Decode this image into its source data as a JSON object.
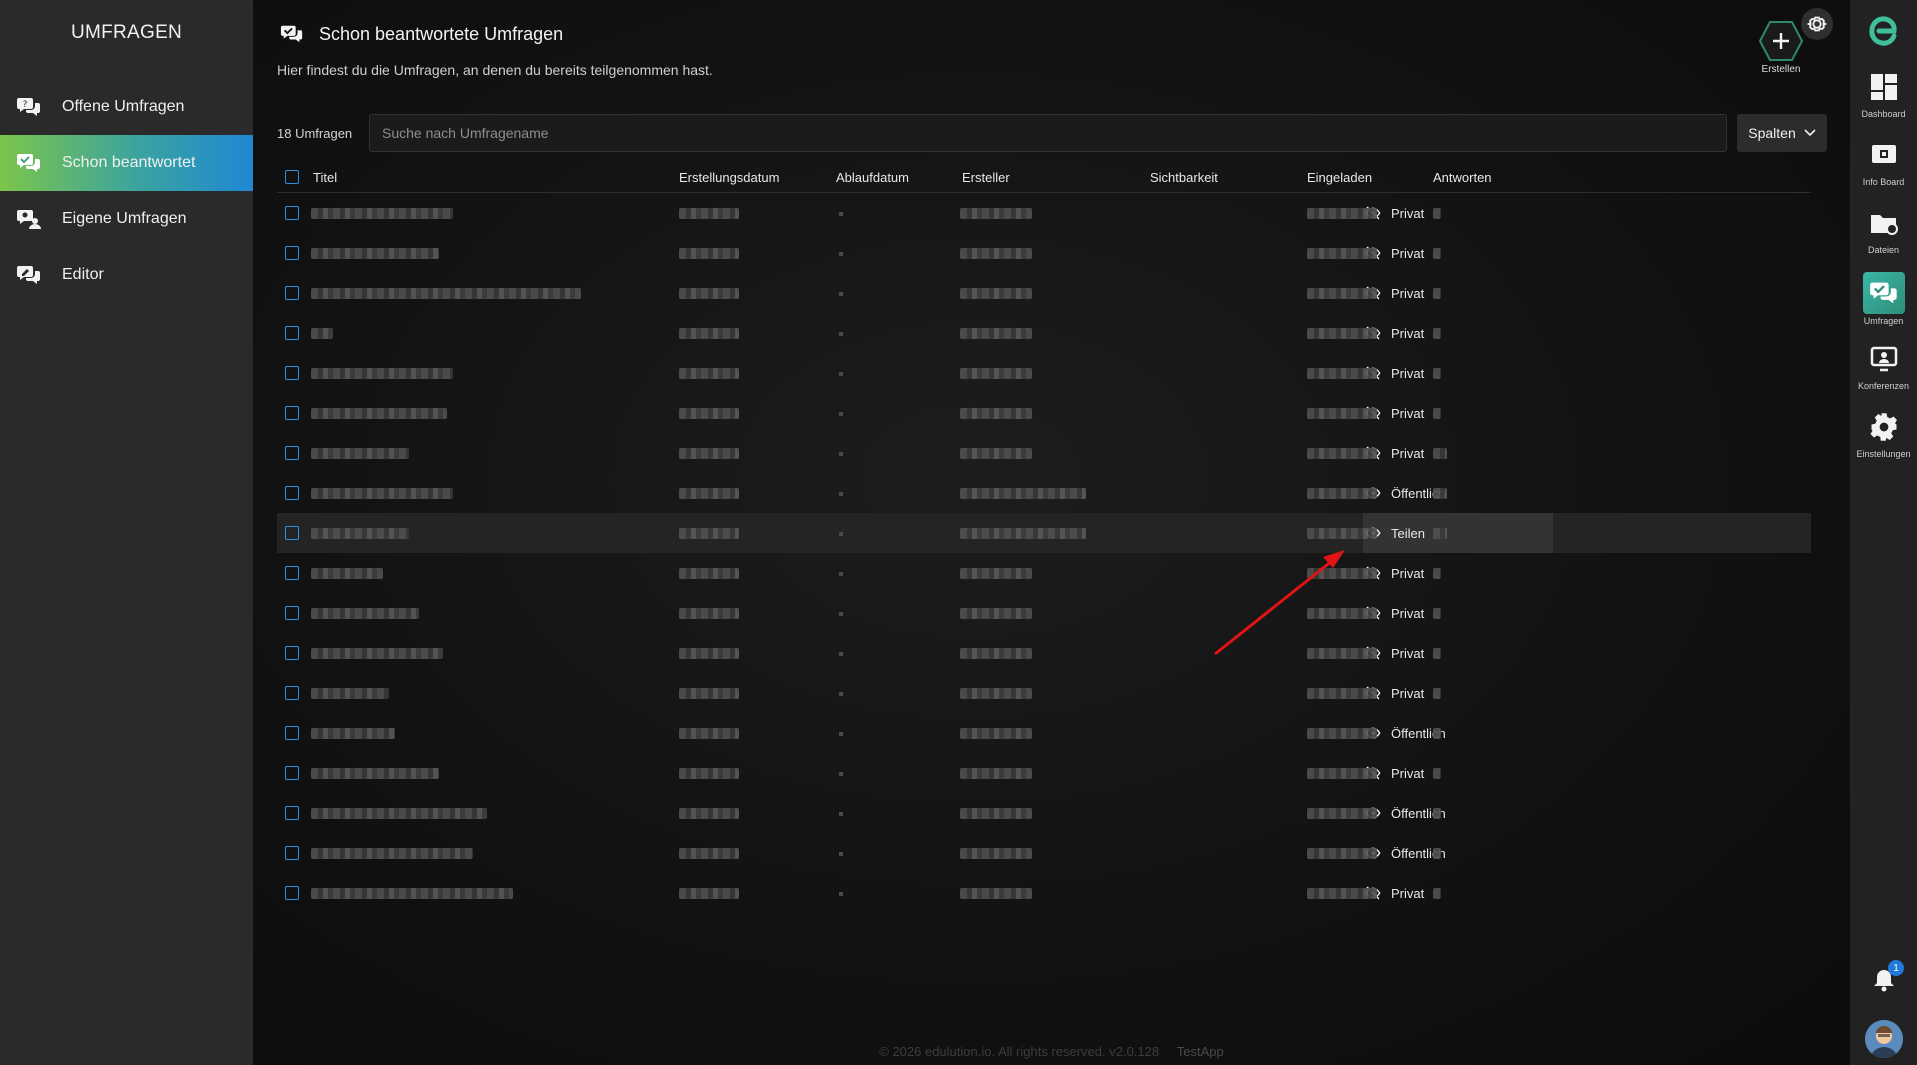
{
  "sidebar": {
    "title": "UMFRAGEN",
    "items": [
      {
        "label": "Offene Umfragen",
        "active": false
      },
      {
        "label": "Schon beantwortet",
        "active": true
      },
      {
        "label": "Eigene Umfragen",
        "active": false
      },
      {
        "label": "Editor",
        "active": false
      }
    ]
  },
  "header": {
    "title": "Schon beantwortete Umfragen",
    "description": "Hier findest du die Umfragen, an denen du bereits teilgenommen hast.",
    "create_label": "Erstellen"
  },
  "toolbar": {
    "count_label": "18 Umfragen",
    "search_placeholder": "Suche nach Umfragename",
    "columns_label": "Spalten"
  },
  "table": {
    "columns": [
      "Titel",
      "Erstellungsdatum",
      "Ablaufdatum",
      "Ersteller",
      "Sichtbarkeit",
      "Eingeladen",
      "Antworten"
    ],
    "rows": [
      {
        "visibility": "Privat",
        "icon": "eye-off-icon"
      },
      {
        "visibility": "Privat",
        "icon": "eye-off-icon"
      },
      {
        "visibility": "Privat",
        "icon": "eye-off-icon"
      },
      {
        "visibility": "Privat",
        "icon": "eye-off-icon"
      },
      {
        "visibility": "Privat",
        "icon": "eye-off-icon"
      },
      {
        "visibility": "Privat",
        "icon": "eye-off-icon"
      },
      {
        "visibility": "Privat",
        "icon": "eye-off-icon"
      },
      {
        "visibility": "Öffentlich",
        "icon": "eye-icon"
      },
      {
        "visibility": "Teilen",
        "icon": "eye-icon",
        "highlighted": true
      },
      {
        "visibility": "Privat",
        "icon": "eye-off-icon"
      },
      {
        "visibility": "Privat",
        "icon": "eye-off-icon"
      },
      {
        "visibility": "Privat",
        "icon": "eye-off-icon"
      },
      {
        "visibility": "Privat",
        "icon": "eye-off-icon"
      },
      {
        "visibility": "Öffentlich",
        "icon": "eye-icon"
      },
      {
        "visibility": "Privat",
        "icon": "eye-off-icon"
      },
      {
        "visibility": "Öffentlich",
        "icon": "eye-icon"
      },
      {
        "visibility": "Öffentlich",
        "icon": "eye-icon"
      },
      {
        "visibility": "Privat",
        "icon": "eye-off-icon"
      }
    ]
  },
  "footer": {
    "copyright": "© 2026 edulution.io. All rights reserved. v2.0.128",
    "app": "TestApp"
  },
  "right_rail": {
    "items": [
      {
        "label": "Dashboard",
        "icon": "dashboard-icon"
      },
      {
        "label": "Info Board",
        "icon": "info-board-icon"
      },
      {
        "label": "Dateien",
        "icon": "files-icon"
      },
      {
        "label": "Umfragen",
        "icon": "surveys-icon",
        "active": true
      },
      {
        "label": "Konferenzen",
        "icon": "conference-icon"
      },
      {
        "label": "Einstellungen",
        "icon": "settings-icon"
      }
    ],
    "notification_count": "1"
  },
  "colors": {
    "accent_gradient": [
      "#7cc54a",
      "#3aa3a0",
      "#1f88d4"
    ],
    "checkbox": "#2e8fe0",
    "annotation_arrow": "#e01414"
  }
}
